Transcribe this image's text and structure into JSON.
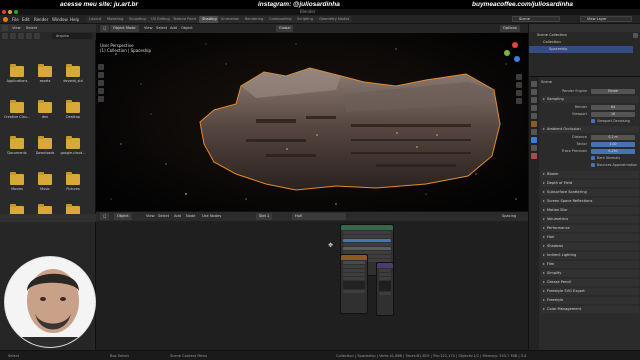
{
  "promo": {
    "left": "acesse meu site: ju.art.br",
    "center": "instagram: @juliosardinha",
    "right": "buymeacoffee.com/juliosardinha"
  },
  "app_title": "Blender",
  "menu": [
    "File",
    "Edit",
    "Render",
    "Window",
    "Help"
  ],
  "workspace_tabs": [
    "Layout",
    "Modeling",
    "Sculpting",
    "UV Editing",
    "Texture Paint",
    "Shading",
    "Animation",
    "Rendering",
    "Compositing",
    "Scripting",
    "Geometry Nodes"
  ],
  "active_workspace": "Shading",
  "scene_selector": "Scene",
  "view_layer_selector": "View Layer",
  "file_browser": {
    "header": [
      "View",
      "Select"
    ],
    "path": "Arquivo",
    "folders": [
      "Applications",
      "assets",
      "devedd_std",
      "Creative Clou...",
      "dev",
      "Desktop",
      "Documents",
      "Downloads",
      "google-cloud...",
      "Movies",
      "Music",
      "Pictures",
      "",
      "",
      ""
    ]
  },
  "viewport": {
    "header": {
      "mode": "Object Mode",
      "items": [
        "View",
        "Select",
        "Add",
        "Object"
      ],
      "transform": "Global",
      "options": "Options"
    },
    "info_line1": "User Perspective",
    "info_line2": "(1) Collection | Spaceship"
  },
  "node_editor": {
    "header": {
      "type": "Object",
      "items": [
        "View",
        "Select",
        "Add",
        "Node"
      ],
      "use_nodes": "Use Nodes",
      "slot": "Slot 1",
      "material": "Hull",
      "spacing": "Spacing"
    }
  },
  "outliner": {
    "rows": [
      "Scene Collection",
      "Collection",
      "Spaceship"
    ]
  },
  "properties": {
    "scene_label": "Scene",
    "render_engine_label": "Render Engine",
    "render_engine": "Eevee",
    "sections": [
      "Sampling",
      "Ambient Occlusion",
      "Bloom",
      "Depth of Field",
      "Subsurface Scattering",
      "Screen Space Reflections",
      "Motion Blur",
      "Volumetrics",
      "Performance",
      "Hair",
      "Shadows",
      "Indirect Lighting",
      "Film",
      "Simplify",
      "Grease Pencil",
      "Freestyle SVG Export",
      "Freestyle",
      "Color Management"
    ],
    "sampling": {
      "render_label": "Render",
      "render": "64",
      "viewport_label": "Viewport",
      "viewport": "16",
      "denoise": "Viewport Denoising"
    },
    "ao": {
      "distance_label": "Distance",
      "distance": "0.2 m",
      "factor_label": "Factor",
      "factor": "1.00",
      "precision_label": "Trace Precision",
      "precision": "0.250",
      "bent_normals": "Bent Normals",
      "bounces": "Bounces Approximation"
    }
  },
  "statusbar": {
    "left": "Select",
    "mid": "Box Select",
    "mid2": "Scene Context Menu",
    "right": "Collection | Spaceship | Verts:41,866 | Faces:61,819 | Tris:122,170 | Objects:1/1 | Memory: 553.7 MiB | 3.4"
  },
  "colors": {
    "accent_blue": "#4772b3",
    "folder": "#d8a838",
    "selection_outline": "#e38b2a",
    "panel_bg": "#2b2b2b"
  }
}
